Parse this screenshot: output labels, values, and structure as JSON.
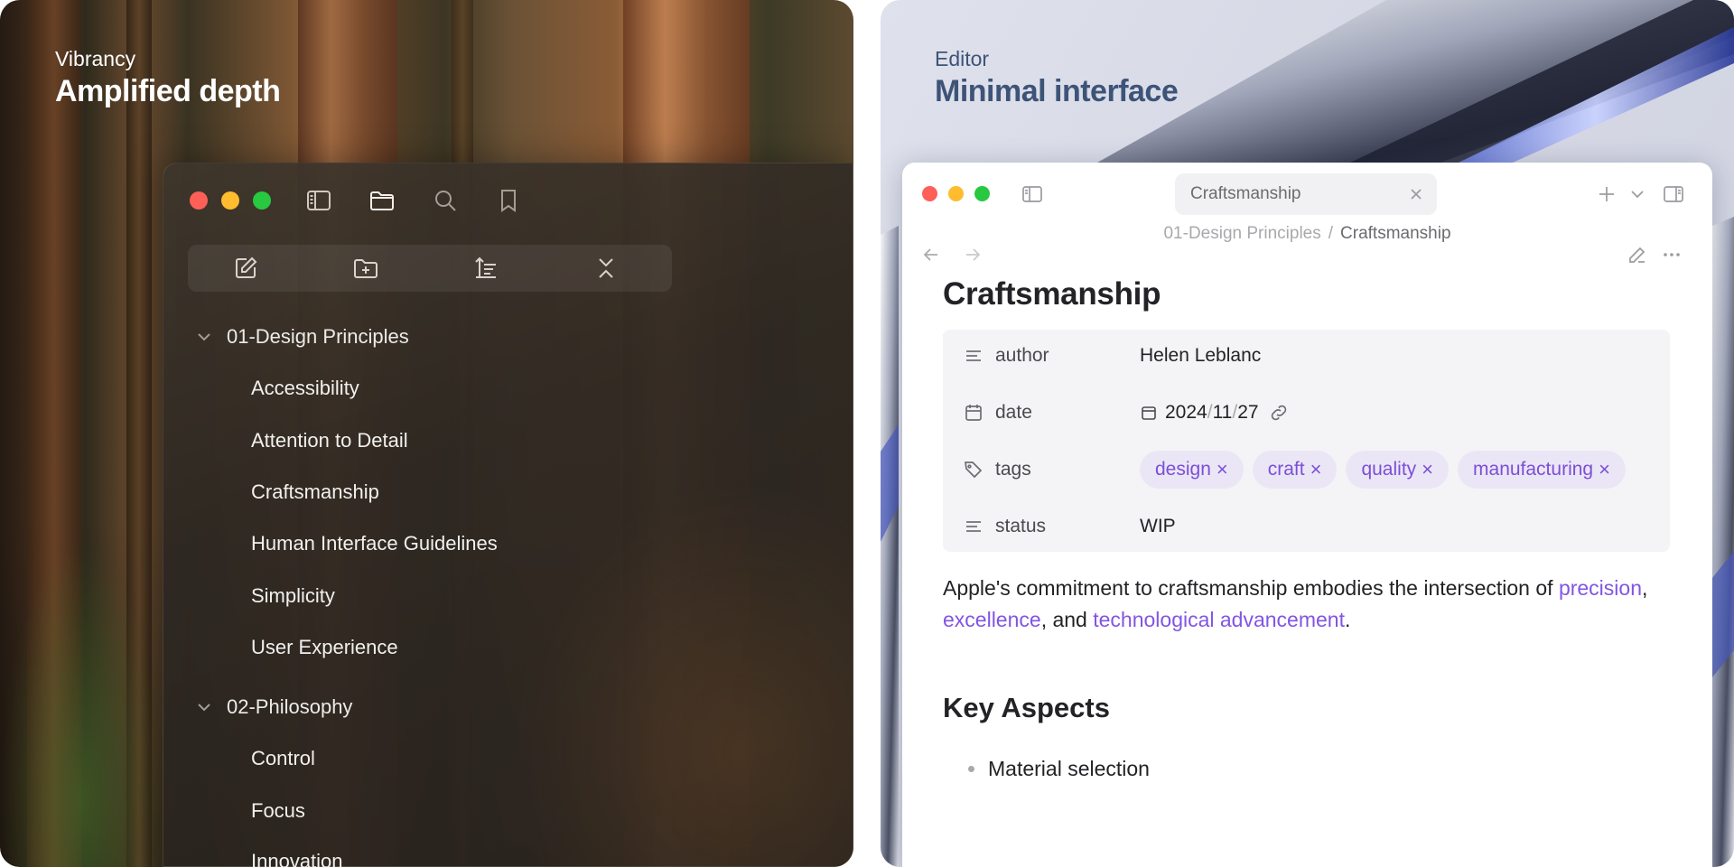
{
  "left_panel": {
    "caption_small": "Vibrancy",
    "caption_big": "Amplified depth",
    "toolbar_icons": [
      "sidebar-toggle-icon",
      "folder-icon",
      "search-icon",
      "bookmark-icon"
    ],
    "actions": [
      "new-note-icon",
      "new-folder-icon",
      "sort-icon",
      "collapse-all-icon"
    ],
    "tree": [
      {
        "folder": "01-Design Principles",
        "items": [
          "Accessibility",
          "Attention to Detail",
          "Craftsmanship",
          "Human Interface Guidelines",
          "Simplicity",
          "User Experience"
        ]
      },
      {
        "folder": "02-Philosophy",
        "items": [
          "Control",
          "Focus",
          "Innovation"
        ]
      }
    ]
  },
  "right_panel": {
    "caption_small": "Editor",
    "caption_big": "Minimal interface",
    "tab_title": "Craftsmanship",
    "breadcrumb": {
      "parent": "01-Design Principles",
      "separator": "/",
      "current": "Craftsmanship"
    },
    "doc_title": "Craftsmanship",
    "properties": {
      "author": {
        "key": "author",
        "value": "Helen Leblanc"
      },
      "date": {
        "key": "date",
        "year": "2024",
        "month": "11",
        "day": "27",
        "sep": "/"
      },
      "tags": {
        "key": "tags",
        "values": [
          "design",
          "craft",
          "quality",
          "manufacturing"
        ],
        "remove_glyph": "×"
      },
      "status": {
        "key": "status",
        "value": "WIP"
      }
    },
    "body": {
      "text_before": "Apple's commitment to craftsmanship embodies the intersection of ",
      "link1": "precision",
      "comma1": ", ",
      "link2": "excellence",
      "mid": ", and ",
      "link3": "technological advancement",
      "end": "."
    },
    "heading": "Key Aspects",
    "bullet1": "Material selection"
  },
  "colors": {
    "accent_purple": "#8255e3",
    "tag_bg": "#ebe6f6",
    "traffic_red": "#fe5f57",
    "traffic_yellow": "#febc2e",
    "traffic_green": "#28c840"
  }
}
